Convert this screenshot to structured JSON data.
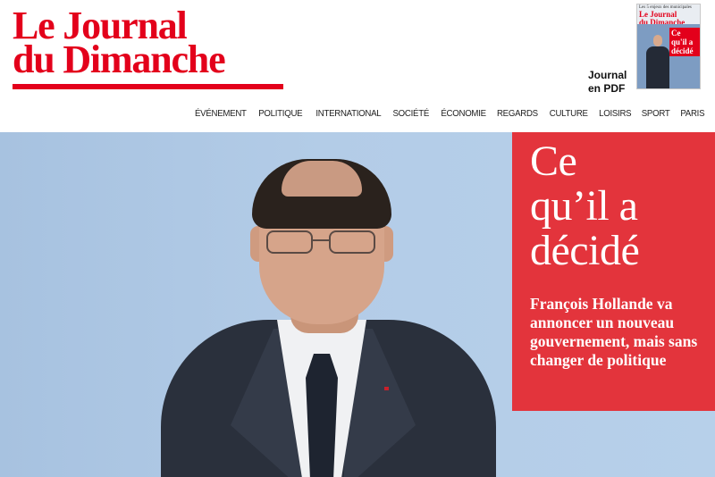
{
  "header": {
    "logo_line1": "Le Journal",
    "logo_line2": "du Dimanche",
    "pdf": {
      "label_line1": "Journal",
      "label_line2": "en PDF",
      "thumb_top": "Les 5 enjeux des municipales",
      "thumb_logo_line1": "Le Journal",
      "thumb_logo_line2": "du Dimanche",
      "thumb_headline": "Ce qu'il a décidé"
    }
  },
  "nav": {
    "items": [
      "ÉVÉNEMENT",
      "POLITIQUE",
      "INTERNATIONAL",
      "SOCIÉTÉ",
      "ÉCONOMIE",
      "REGARDS",
      "CULTURE",
      "LOISIRS",
      "SPORT",
      "PARIS"
    ]
  },
  "hero": {
    "headline": "Ce qu’il a décidé",
    "headline_line1": "Ce",
    "headline_line2": "qu’il a",
    "headline_line3": "décidé",
    "subheadline": "François Hollande va annoncer un nouveau gouvernement, mais sans changer de politique"
  },
  "colors": {
    "brand_red": "#e3001b",
    "headline_box": "#e3343c",
    "hero_background": "#a9c4e2"
  }
}
